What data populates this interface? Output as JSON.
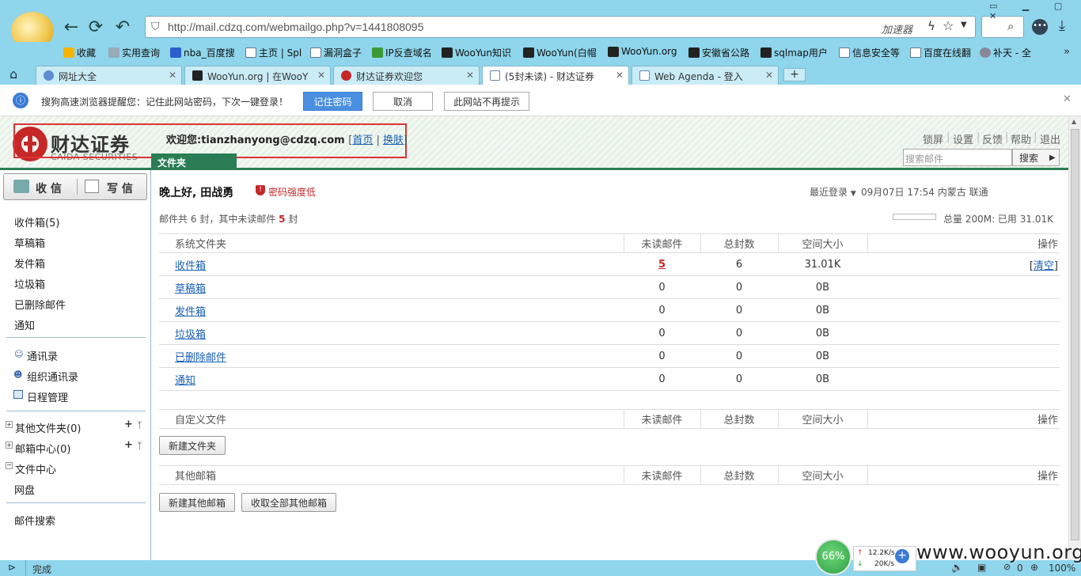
{
  "browser": {
    "url": "http://mail.cdzq.com/webmailgo.php?v=1441808095",
    "accelerator": "加速器",
    "bookmarks": [
      "收藏",
      "实用查询",
      "nba_百度搜",
      "主页 | Spl",
      "漏洞盒子",
      "IP反查域名",
      "WooYun知识",
      "WooYun(白帽",
      "WooYun.org",
      "安徽省公路",
      "sqlmap用户",
      "信息安全等",
      "百度在线翻",
      "补天 - 全"
    ],
    "tabs": [
      "网址大全",
      "WooYun.org | 在WooY",
      "财达证券欢迎您",
      "(5封未读) - 财达证券",
      "Web Agenda - 登入"
    ],
    "notice": {
      "text": "搜狗高速浏览器提醒您：记住此网站密码，下次一键登录！",
      "remember": "记住密码",
      "cancel": "取消",
      "never": "此网站不再提示"
    },
    "status": "完成",
    "watermark": "www.wooyun.org",
    "cpu": "66%",
    "up_speed": "12.2K/s",
    "down_speed": "20K/s",
    "zoom": "100%",
    "count": "0"
  },
  "header": {
    "logo_cn": "财达证券",
    "logo_en": "CAIDA SECURITIES",
    "welcome": "欢迎您:tianzhanyong@cdzq.com",
    "home": "首页",
    "switch": "换肤",
    "folder_tab": "文件夹",
    "links": [
      "锁屏",
      "设置",
      "反馈",
      "帮助",
      "退出"
    ],
    "search_placeholder": "搜索邮件",
    "search_button": "搜索"
  },
  "sidebar": {
    "receive": "收 信",
    "compose": "写 信",
    "folders": [
      "收件箱(5)",
      "草稿箱",
      "发件箱",
      "垃圾箱",
      "已删除邮件",
      "通知"
    ],
    "tools": [
      "通讯录",
      "组织通讯录",
      "日程管理"
    ],
    "groups": [
      "其他文件夹(0)",
      "邮箱中心(0)",
      "文件中心"
    ],
    "disk": "网盘",
    "mail_search": "邮件搜索"
  },
  "main": {
    "greeting": "晚上好, 田战勇",
    "password_warning": "密码强度低",
    "last_login_label": "最近登录",
    "last_login": "09月07日 17:54 内蒙古 联通",
    "summary_a": "邮件共",
    "summary_total": "6",
    "summary_b": "封，其中未读邮件",
    "summary_unread": "5",
    "summary_c": "封",
    "quota": "总量 200M: 已用 31.01K",
    "quota_fraction": 0.0,
    "cols": {
      "unread": "未读邮件",
      "total": "总封数",
      "size": "空间大小",
      "ops": "操作"
    },
    "system_title": "系统文件夹",
    "clear": "清空",
    "system_rows": [
      {
        "name": "收件箱",
        "unread": "5",
        "total": "6",
        "size": "31.01K"
      },
      {
        "name": "草稿箱",
        "unread": "0",
        "total": "0",
        "size": "0B"
      },
      {
        "name": "发件箱",
        "unread": "0",
        "total": "0",
        "size": "0B"
      },
      {
        "name": "垃圾箱",
        "unread": "0",
        "total": "0",
        "size": "0B"
      },
      {
        "name": "已删除邮件",
        "unread": "0",
        "total": "0",
        "size": "0B"
      },
      {
        "name": "通知",
        "unread": "0",
        "total": "0",
        "size": "0B"
      }
    ],
    "custom_title": "自定义文件",
    "new_folder": "新建文件夹",
    "other_title": "其他邮箱",
    "new_other": "新建其他邮箱",
    "fetch_all": "收取全部其他邮箱"
  },
  "colors": {
    "accent_green": "#2a7d55",
    "brand_red": "#c62828",
    "browser_blue": "#8fd5ec"
  }
}
